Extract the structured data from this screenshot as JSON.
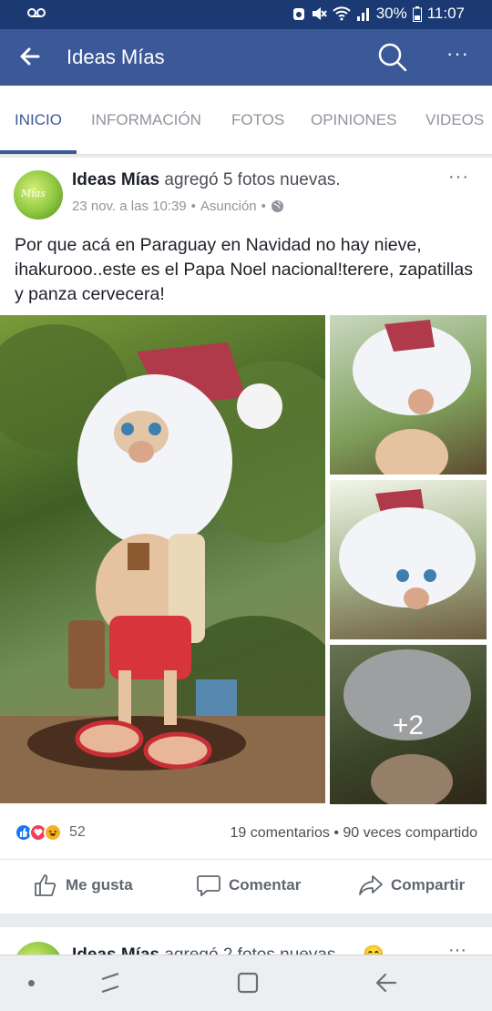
{
  "status_bar": {
    "battery": "30%",
    "time": "11:07"
  },
  "app_bar": {
    "title": "Ideas Mías"
  },
  "tabs": [
    {
      "label": "INICIO",
      "active": true
    },
    {
      "label": "INFORMACIÓN",
      "active": false
    },
    {
      "label": "FOTOS",
      "active": false
    },
    {
      "label": "OPINIONES",
      "active": false
    },
    {
      "label": "VIDEOS",
      "active": false
    }
  ],
  "post": {
    "author": "Ideas Mías",
    "action": "agregó 5 fotos nuevas.",
    "date": "23 nov. a las 10:39",
    "location": "Asunción",
    "text": "Por que acá en Paraguay en Navidad no hay nieve, ihakurooo..este es el Papa Noel nacional!terere, zapatillas y panza cervecera!",
    "more_photos": "+2",
    "reaction_count": "52",
    "engagement": "19 comentarios • 90 veces compartido",
    "actions": {
      "like": "Me gusta",
      "comment": "Comentar",
      "share": "Compartir"
    }
  },
  "post2": {
    "author": "Ideas Mías",
    "action": "agregó 2 fotos nuevas — 😊"
  },
  "colors": {
    "brand": "#3b5998",
    "status_bar": "#1b3a73"
  }
}
